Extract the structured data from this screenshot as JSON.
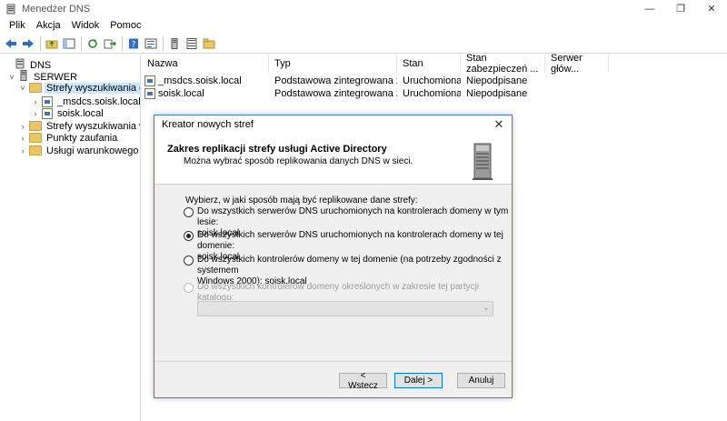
{
  "window": {
    "title": "Menedżer DNS",
    "controls": {
      "minimize": "—",
      "restore": "❐",
      "close": "✕"
    }
  },
  "menu": [
    "Plik",
    "Akcja",
    "Widok",
    "Pomoc"
  ],
  "toolbar": {
    "icons": [
      "back-icon",
      "forward-icon",
      "up-folder-icon",
      "show-hide-tree-icon",
      "refresh-icon",
      "export-icon",
      "help-icon",
      "properties-icon",
      "server-icon",
      "list-icon",
      "folder-icon"
    ]
  },
  "tree": {
    "items": [
      {
        "label": "DNS"
      },
      {
        "label": "SERWER"
      },
      {
        "label": "Strefy wyszukiwania do p"
      },
      {
        "label": "_msdcs.soisk.local"
      },
      {
        "label": "soisk.local"
      },
      {
        "label": "Strefy wyszukiwania wste"
      },
      {
        "label": "Punkty zaufania"
      },
      {
        "label": "Usługi warunkowego prz"
      }
    ]
  },
  "list": {
    "columns": [
      "Nazwa",
      "Typ",
      "Stan",
      "Stan zabezpieczeń ...",
      "Serwer głów..."
    ],
    "rows": [
      {
        "name": "_msdcs.soisk.local",
        "type": "Podstawowa zintegrowana z u...",
        "status": "Uruchomiona",
        "security": "Niepodpisane",
        "master": ""
      },
      {
        "name": "soisk.local",
        "type": "Podstawowa zintegrowana z u...",
        "status": "Uruchomiona",
        "security": "Niepodpisane",
        "master": ""
      }
    ]
  },
  "dialog": {
    "title": "Kreator nowych stref",
    "close": "✕",
    "heading": "Zakres replikacji strefy usługi Active Directory",
    "subheading": "Można wybrać sposób replikowania danych DNS w sieci.",
    "prompt": "Wybierz, w jaki sposób mają być replikowane dane strefy:",
    "options": [
      {
        "line1": "Do wszystkich serwerów DNS uruchomionych na kontrolerach domeny w tym lesie:",
        "line2": "soisk.local",
        "checked": false,
        "enabled": true
      },
      {
        "line1": "Do wszystkich serwerów DNS uruchomionych na kontrolerach domeny w tej domenie:",
        "line2": "soisk.local",
        "checked": true,
        "enabled": true
      },
      {
        "line1": "Do wszystkich kontrolerów domeny w tej domenie (na potrzeby zgodności z systemem",
        "line2": "Windows 2000): soisk.local",
        "checked": false,
        "enabled": true
      },
      {
        "line1": "Do wszystkich kontrolerów domeny określonych w zakresie tej partycji katalogu:",
        "line2": "",
        "checked": false,
        "enabled": false
      }
    ],
    "combo_value": "",
    "buttons": {
      "back": "< Wstecz",
      "next": "Dalej >",
      "cancel": "Anuluj"
    }
  }
}
